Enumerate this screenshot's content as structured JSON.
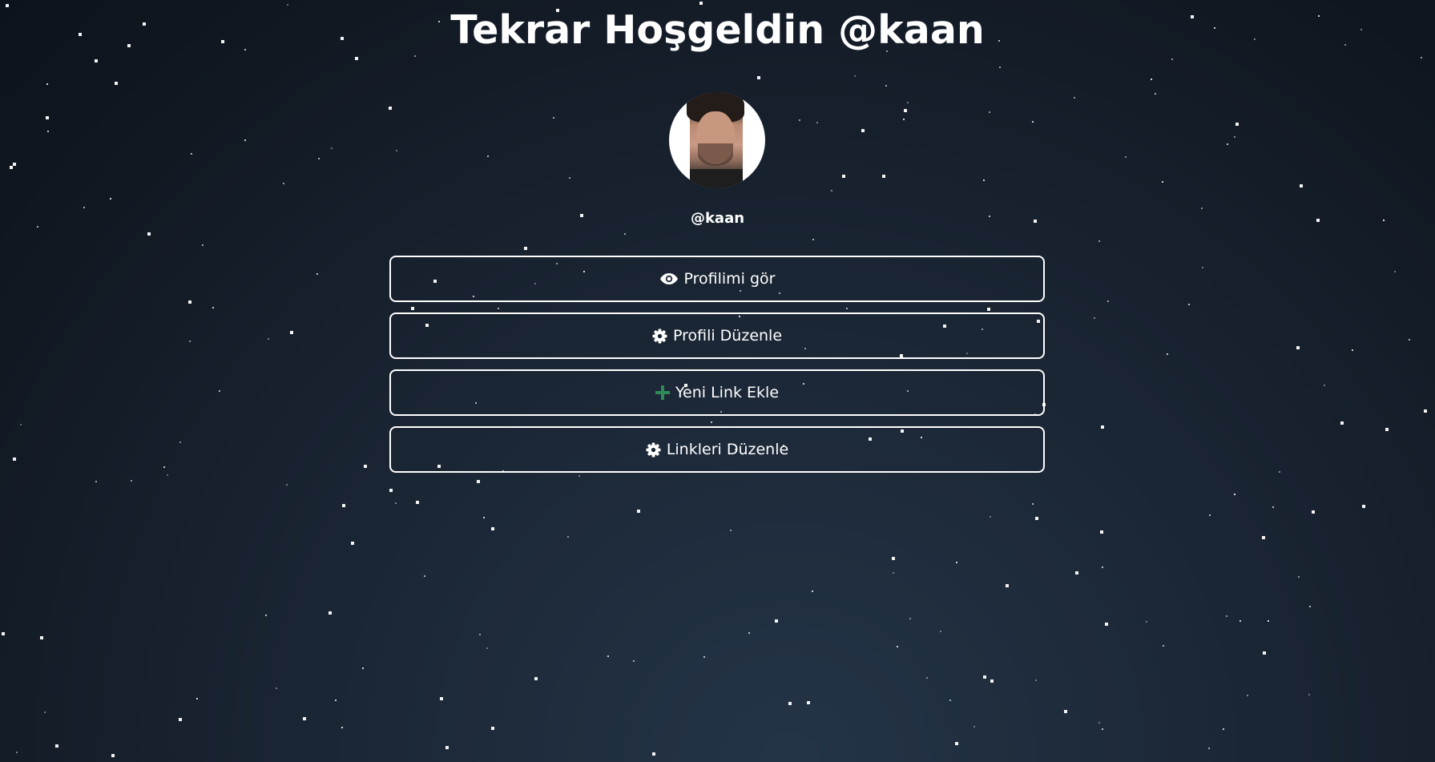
{
  "header": {
    "title": "Tekrar Hoşgeldin @kaan"
  },
  "profile": {
    "username": "@kaan"
  },
  "actions": [
    {
      "label": "Profilimi gör",
      "icon": "eye-icon"
    },
    {
      "label": "Profili Düzenle",
      "icon": "gear-icon"
    },
    {
      "label": "Yeni Link Ekle",
      "icon": "plus-icon"
    },
    {
      "label": "Linkleri Düzenle",
      "icon": "gear-icon"
    }
  ],
  "colors": {
    "background_top": "#0d131b",
    "background_center": "#243447",
    "text": "#ffffff",
    "button_border": "#ffffff",
    "plus_icon": "#2e8b57"
  }
}
